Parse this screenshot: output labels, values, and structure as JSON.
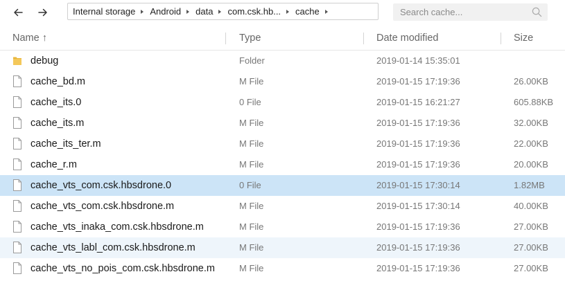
{
  "nav": {
    "back_icon": "back-arrow-icon",
    "forward_icon": "forward-arrow-icon"
  },
  "breadcrumb": [
    "Internal storage",
    "Android",
    "data",
    "com.csk.hb...",
    "cache"
  ],
  "search": {
    "placeholder": "Search cache...",
    "icon": "search-icon"
  },
  "columns": {
    "name": "Name ↑",
    "type": "Type",
    "date": "Date modified",
    "size": "Size"
  },
  "files": [
    {
      "name": "debug",
      "type": "Folder",
      "date": "2019-01-14 15:35:01",
      "size": "",
      "kind": "folder"
    },
    {
      "name": "cache_bd.m",
      "type": "M File",
      "date": "2019-01-15 17:19:36",
      "size": "26.00KB",
      "kind": "file"
    },
    {
      "name": "cache_its.0",
      "type": "0 File",
      "date": "2019-01-15 16:21:27",
      "size": "605.88KB",
      "kind": "file"
    },
    {
      "name": "cache_its.m",
      "type": "M File",
      "date": "2019-01-15 17:19:36",
      "size": "32.00KB",
      "kind": "file"
    },
    {
      "name": "cache_its_ter.m",
      "type": "M File",
      "date": "2019-01-15 17:19:36",
      "size": "22.00KB",
      "kind": "file"
    },
    {
      "name": "cache_r.m",
      "type": "M File",
      "date": "2019-01-15 17:19:36",
      "size": "20.00KB",
      "kind": "file"
    },
    {
      "name": "cache_vts_com.csk.hbsdrone.0",
      "type": "0 File",
      "date": "2019-01-15 17:30:14",
      "size": "1.82MB",
      "kind": "file",
      "state": "selected"
    },
    {
      "name": "cache_vts_com.csk.hbsdrone.m",
      "type": "M File",
      "date": "2019-01-15 17:30:14",
      "size": "40.00KB",
      "kind": "file"
    },
    {
      "name": "cache_vts_inaka_com.csk.hbsdrone.m",
      "type": "M File",
      "date": "2019-01-15 17:19:36",
      "size": "27.00KB",
      "kind": "file"
    },
    {
      "name": "cache_vts_labl_com.csk.hbsdrone.m",
      "type": "M File",
      "date": "2019-01-15 17:19:36",
      "size": "27.00KB",
      "kind": "file",
      "state": "hover"
    },
    {
      "name": "cache_vts_no_pois_com.csk.hbsdrone.m",
      "type": "M File",
      "date": "2019-01-15 17:19:36",
      "size": "27.00KB",
      "kind": "file"
    }
  ],
  "colors": {
    "selected": "#cce4f7",
    "hover": "#eef5fb",
    "folder": "#e8b63a"
  }
}
